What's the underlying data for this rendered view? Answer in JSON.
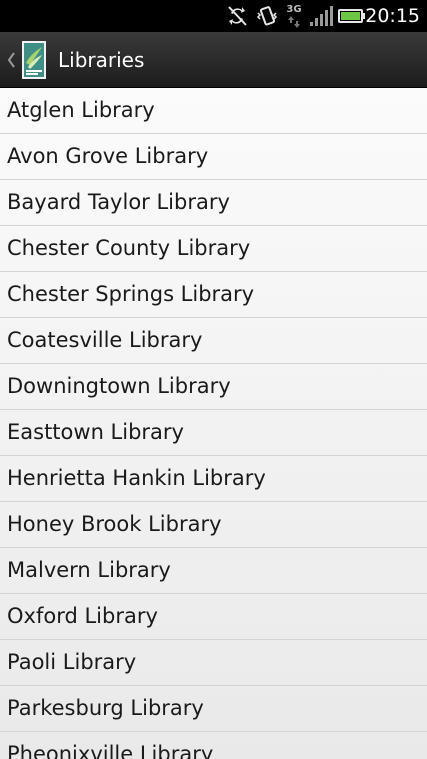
{
  "status_bar": {
    "time": "20:15",
    "network_label": "3G",
    "icons": [
      "sync-off-icon",
      "vibrate-icon",
      "3g-data-icon",
      "signal-icon",
      "battery-icon"
    ],
    "battery_color": "#6cc644"
  },
  "action_bar": {
    "title": "Libraries",
    "back_icon": "chevron-left-icon",
    "logo_icon": "app-logo-icon"
  },
  "libraries": [
    "Atglen Library",
    "Avon Grove Library",
    "Bayard Taylor Library",
    "Chester County Library",
    "Chester Springs Library",
    "Coatesville Library",
    "Downingtown Library",
    "Easttown Library",
    "Henrietta Hankin Library",
    "Honey Brook Library",
    "Malvern Library",
    "Oxford Library",
    "Paoli Library",
    "Parkesburg Library",
    "Pheonixville Library"
  ]
}
